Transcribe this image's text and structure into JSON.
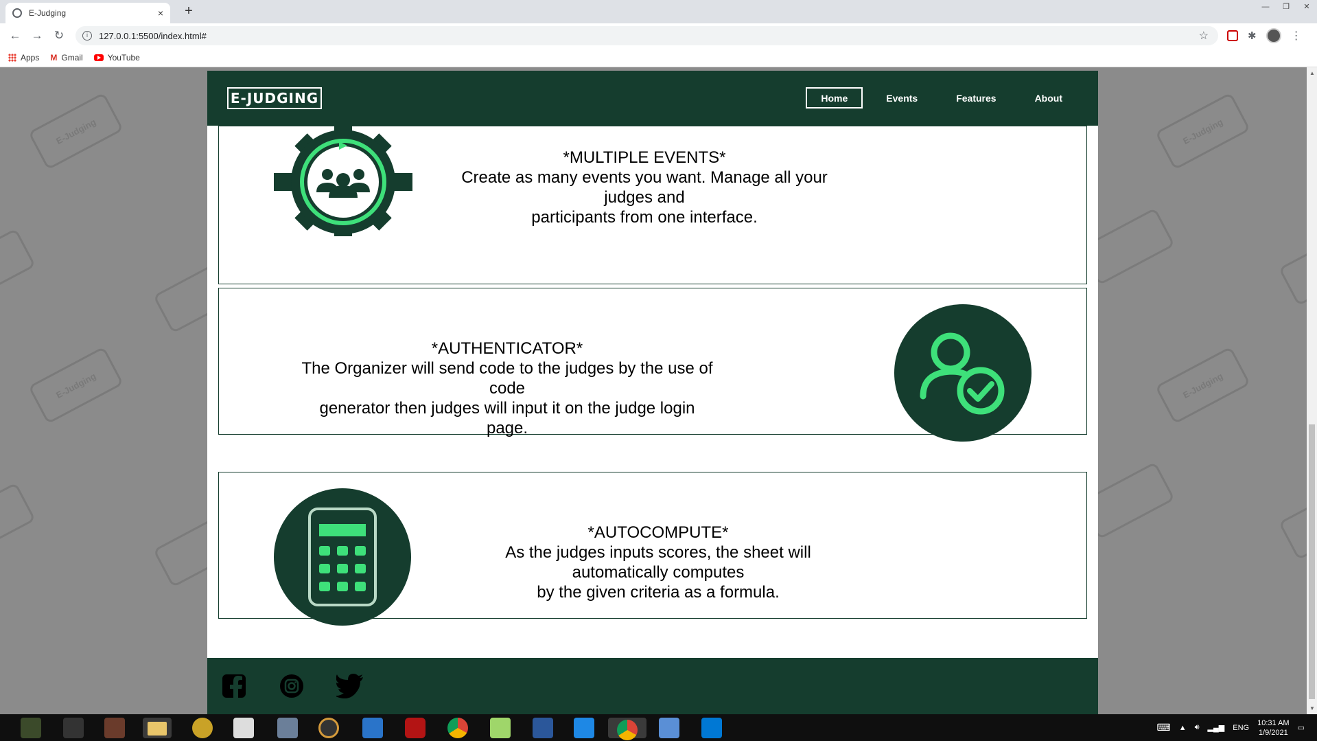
{
  "browser": {
    "tab_title": "E-Judging",
    "tab_close": "×",
    "new_tab": "+",
    "url": "127.0.0.1:5500/index.html#",
    "bookmarks": [
      {
        "label": "Apps",
        "icon": "apps-grid-icon"
      },
      {
        "label": "Gmail",
        "icon": "gmail-icon"
      },
      {
        "label": "YouTube",
        "icon": "youtube-icon"
      }
    ]
  },
  "site": {
    "logo": "E-JUDGING",
    "nav": [
      {
        "label": "Home",
        "active": true
      },
      {
        "label": "Events",
        "active": false
      },
      {
        "label": "Features",
        "active": false
      },
      {
        "label": "About",
        "active": false
      }
    ],
    "features": [
      {
        "title": "*MULTIPLE EVENTS*",
        "line1": "Create as many events you want. Manage all your judges and",
        "line2": "participants from one interface."
      },
      {
        "title": "*AUTHENTICATOR*",
        "line1": "The Organizer will send code to the judges by the use of code",
        "line2": "generator then judges will input it on the judge login page."
      },
      {
        "title": "*AUTOCOMPUTE*",
        "line1": "As the judges inputs scores, the sheet will automatically computes",
        "line2": "by the given criteria as a formula."
      }
    ],
    "watermark": "E-Judging",
    "colors": {
      "brand": "#153d2e",
      "accent": "#3ee07a"
    }
  },
  "taskbar": {
    "language": "ENG",
    "time": "10:31 AM",
    "date": "1/9/2021"
  }
}
